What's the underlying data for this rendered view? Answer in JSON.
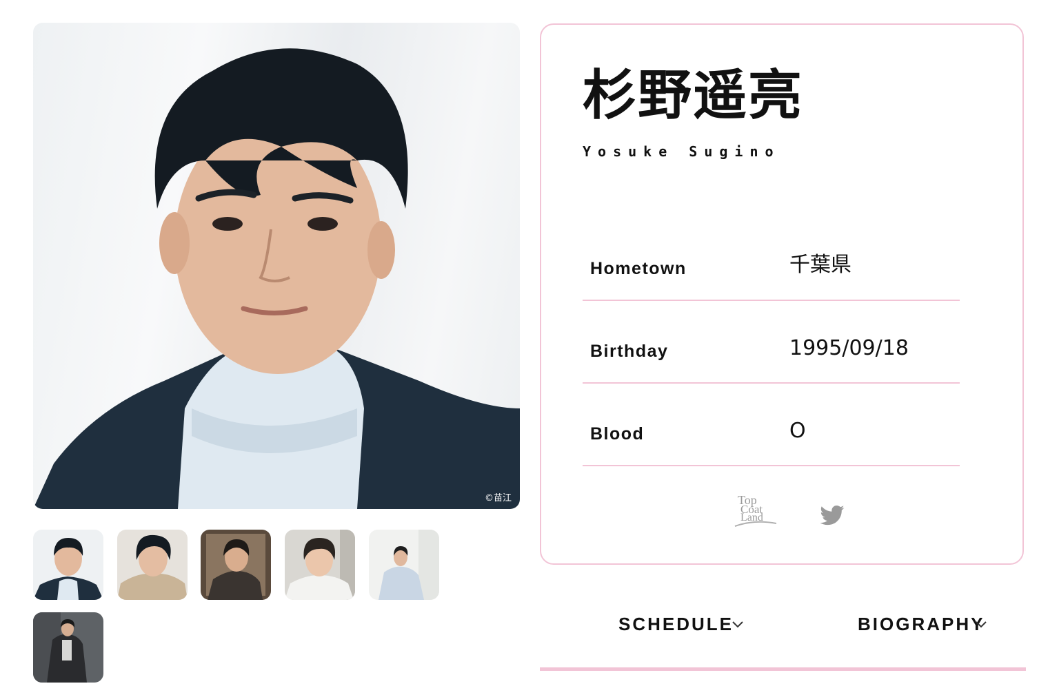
{
  "profile": {
    "name_jp": "杉野遥亮",
    "name_en": "Yosuke Sugino",
    "photo_credit": "©苗江",
    "info": [
      {
        "label": "Hometown",
        "value": "千葉県"
      },
      {
        "label": "Birthday",
        "value": "1995/09/18"
      },
      {
        "label": "Blood",
        "value": "O"
      }
    ]
  },
  "social": {
    "topcoatland_logo": "Top Coat Land",
    "twitter_icon": "twitter-bird-icon"
  },
  "toggles": {
    "schedule": "SCHEDULE",
    "biography": "BIOGRAPHY"
  },
  "thumbnails": [
    "thumbnail-1",
    "thumbnail-2",
    "thumbnail-3",
    "thumbnail-4",
    "thumbnail-5",
    "thumbnail-6"
  ],
  "colors": {
    "accent_pink": "#f2c4d6",
    "text": "#111111",
    "icon_gray": "#9a9a9a"
  }
}
